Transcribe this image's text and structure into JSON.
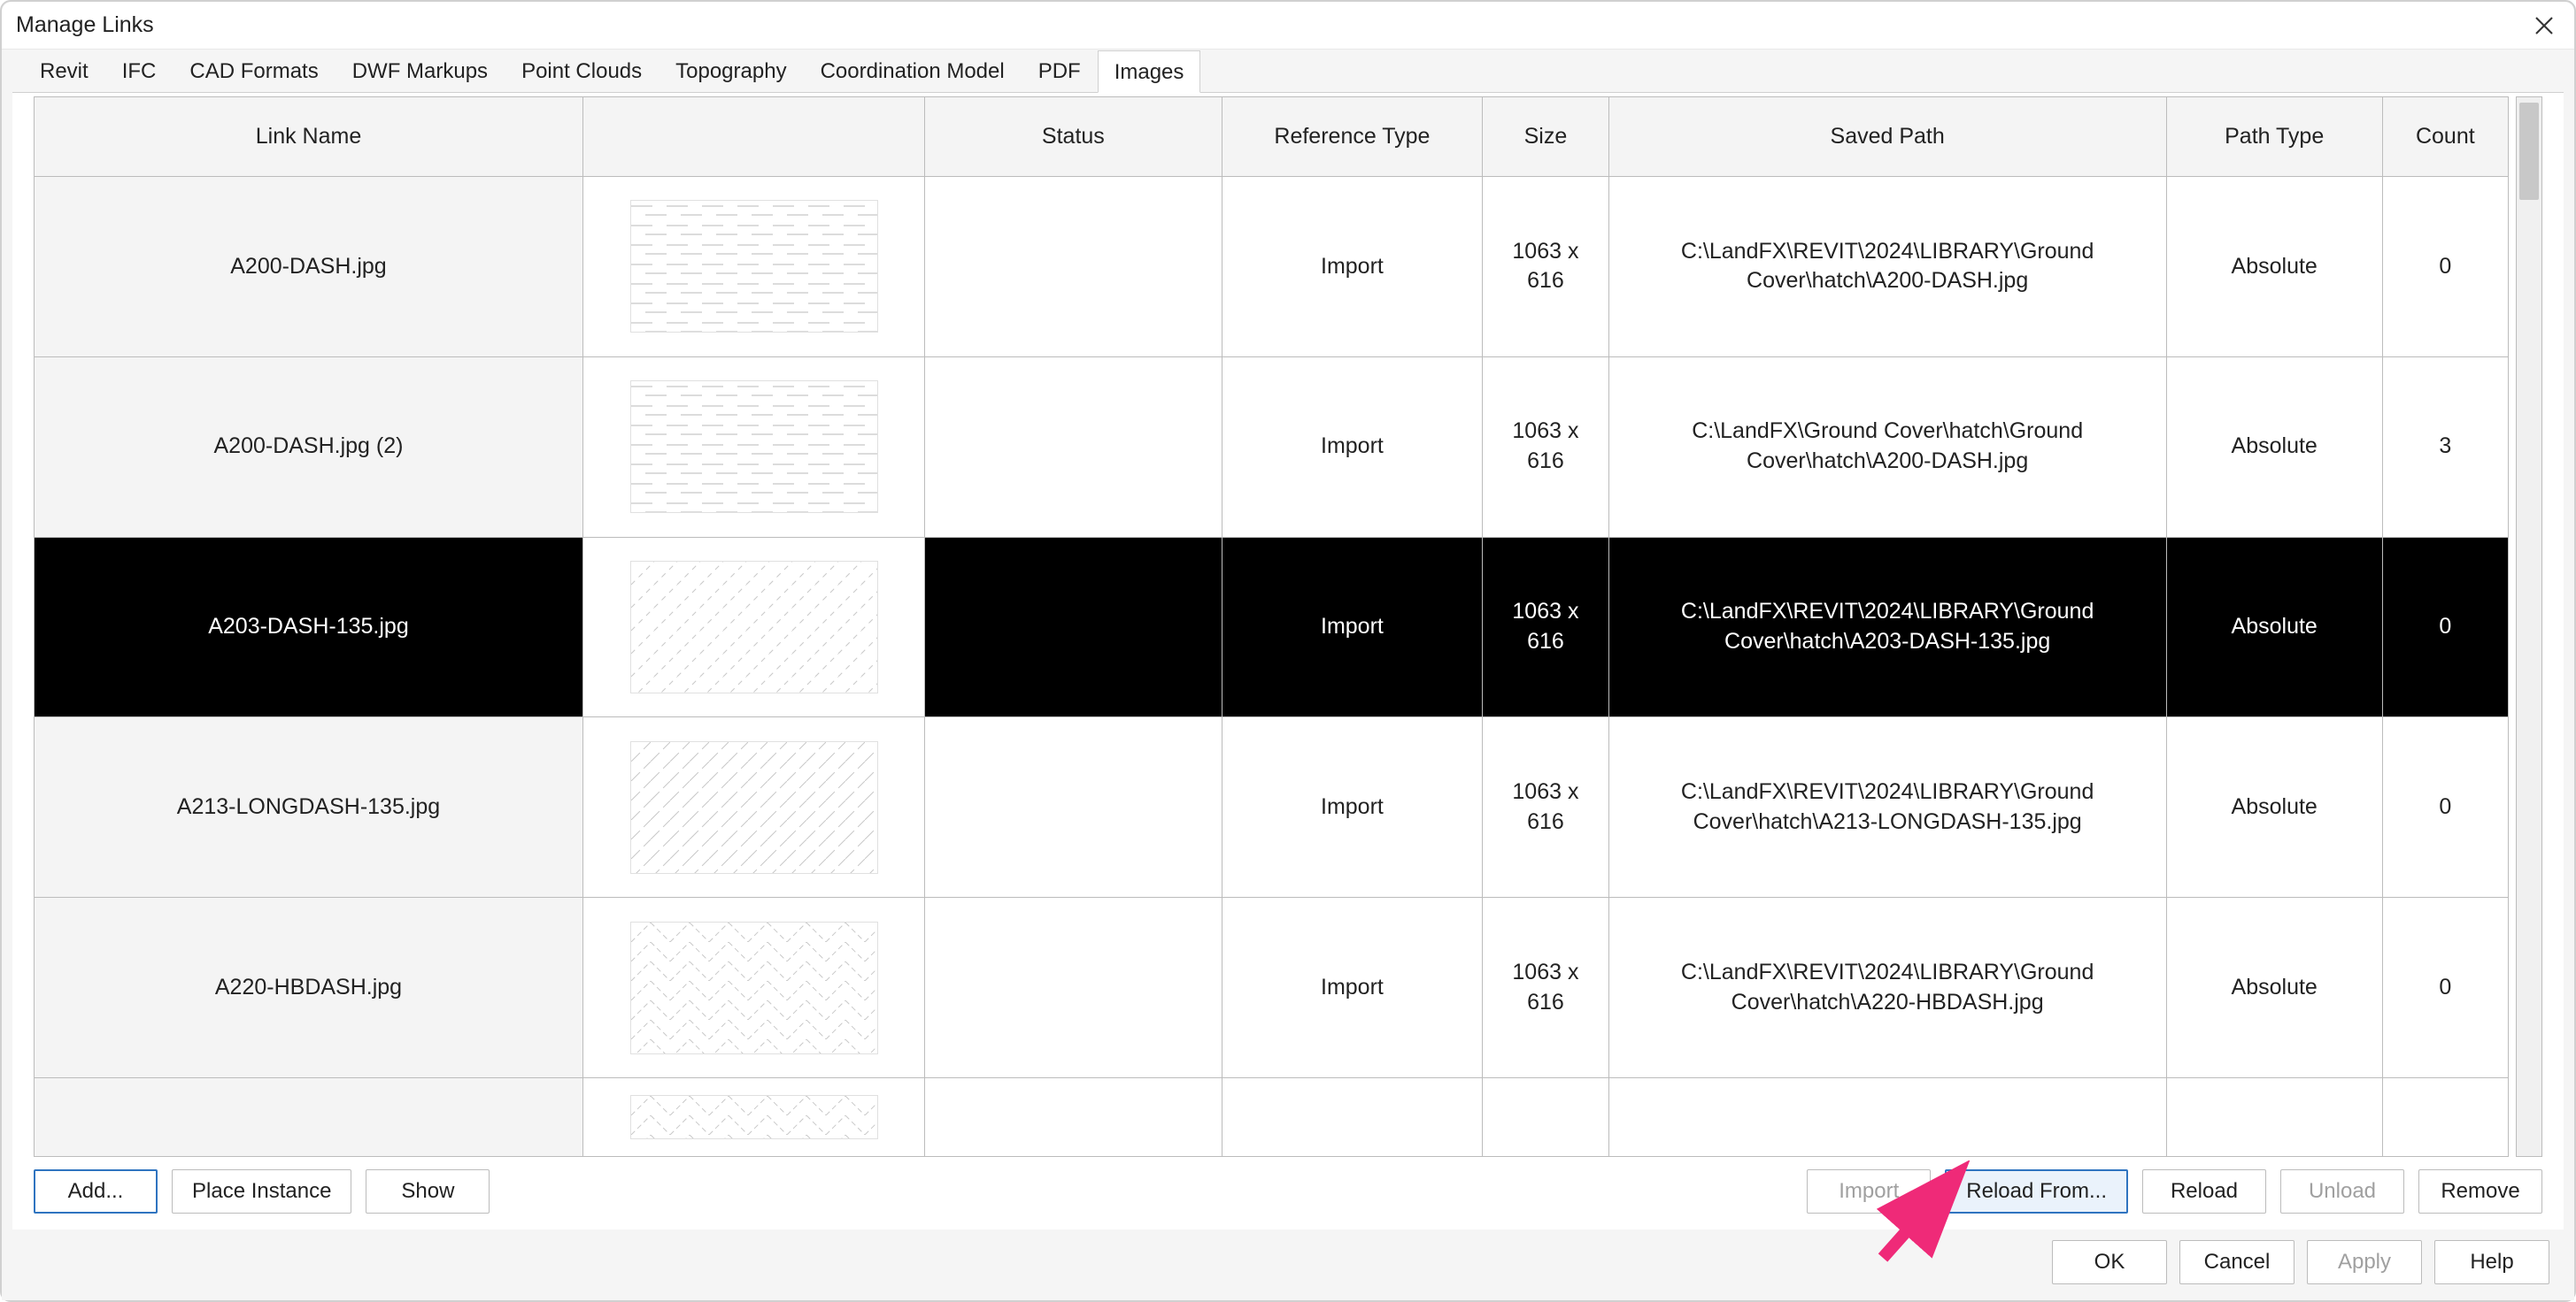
{
  "window": {
    "title": "Manage Links"
  },
  "tabs": [
    {
      "label": "Revit"
    },
    {
      "label": "IFC"
    },
    {
      "label": "CAD Formats"
    },
    {
      "label": "DWF Markups"
    },
    {
      "label": "Point Clouds"
    },
    {
      "label": "Topography"
    },
    {
      "label": "Coordination Model"
    },
    {
      "label": "PDF"
    },
    {
      "label": "Images"
    }
  ],
  "columns": {
    "linkName": "Link Name",
    "preview": "",
    "status": "Status",
    "refType": "Reference Type",
    "size": "Size",
    "savedPath": "Saved Path",
    "pathType": "Path Type",
    "count": "Count"
  },
  "rows": [
    {
      "name": "A200-DASH.jpg",
      "status": "",
      "refType": "Import",
      "size": "1063 x 616",
      "path": "C:\\LandFX\\REVIT\\2024\\LIBRARY\\Ground Cover\\hatch\\A200-DASH.jpg",
      "pathType": "Absolute",
      "count": "0",
      "hatch": "hdash"
    },
    {
      "name": "A200-DASH.jpg (2)",
      "status": "",
      "refType": "Import",
      "size": "1063 x 616",
      "path": "C:\\LandFX\\Ground Cover\\hatch\\Ground Cover\\hatch\\A200-DASH.jpg",
      "pathType": "Absolute",
      "count": "3",
      "hatch": "hdash"
    },
    {
      "name": "A203-DASH-135.jpg",
      "status": "",
      "refType": "Import",
      "size": "1063 x 616",
      "path": "C:\\LandFX\\REVIT\\2024\\LIBRARY\\Ground Cover\\hatch\\A203-DASH-135.jpg",
      "pathType": "Absolute",
      "count": "0",
      "hatch": "diag135"
    },
    {
      "name": "A213-LONGDASH-135.jpg",
      "status": "",
      "refType": "Import",
      "size": "1063 x 616",
      "path": "C:\\LandFX\\REVIT\\2024\\LIBRARY\\Ground Cover\\hatch\\A213-LONGDASH-135.jpg",
      "pathType": "Absolute",
      "count": "0",
      "hatch": "longdash135"
    },
    {
      "name": "A220-HBDASH.jpg",
      "status": "",
      "refType": "Import",
      "size": "1063 x 616",
      "path": "C:\\LandFX\\REVIT\\2024\\LIBRARY\\Ground Cover\\hatch\\A220-HBDASH.jpg",
      "pathType": "Absolute",
      "count": "0",
      "hatch": "herringbone"
    }
  ],
  "actions": {
    "add": "Add...",
    "placeInstance": "Place Instance",
    "show": "Show",
    "import": "Import",
    "reloadFrom": "Reload From...",
    "reload": "Reload",
    "unload": "Unload",
    "remove": "Remove"
  },
  "footer": {
    "ok": "OK",
    "cancel": "Cancel",
    "apply": "Apply",
    "help": "Help"
  }
}
